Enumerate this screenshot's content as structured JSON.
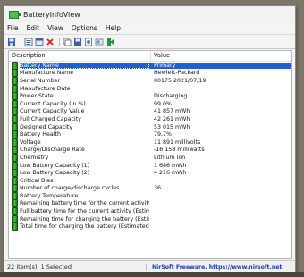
{
  "window": {
    "title": "BatteryInfoView"
  },
  "menu": [
    "File",
    "Edit",
    "View",
    "Options",
    "Help"
  ],
  "toolbar_icons": [
    "save-icon",
    "properties-icon",
    "refresh-icon",
    "delete-icon",
    "copy-icon",
    "save-select-icon",
    "html-report-icon",
    "about-icon",
    "exit-icon"
  ],
  "columns": {
    "description": "Description",
    "value": "Value"
  },
  "rows": [
    {
      "d": "Battery Name",
      "v": "Primary",
      "selected": true
    },
    {
      "d": "Manufacture Name",
      "v": "Hewlett-Packard"
    },
    {
      "d": "Serial Number",
      "v": "00175 2021/07/19"
    },
    {
      "d": "Manufacture Date",
      "v": ""
    },
    {
      "d": "Power State",
      "v": "Discharging"
    },
    {
      "d": "Current Capacity (in %)",
      "v": "99.0%"
    },
    {
      "d": "Current Capacity Value",
      "v": "41 857 mWh"
    },
    {
      "d": "Full Charged Capacity",
      "v": "42 261 mWh"
    },
    {
      "d": "Designed Capacity",
      "v": "53 015 mWh"
    },
    {
      "d": "Battery Health",
      "v": "79.7%"
    },
    {
      "d": "Voltage",
      "v": "11 891 millivolts"
    },
    {
      "d": "Charge/Discharge Rate",
      "v": "-16 158 milliwatts"
    },
    {
      "d": "Chemistry",
      "v": "Lithium Ion"
    },
    {
      "d": "Low Battery Capacity (1)",
      "v": "1 686 mWh"
    },
    {
      "d": "Low Battery Capacity (2)",
      "v": "4 216 mWh"
    },
    {
      "d": "Critical Bias",
      "v": ""
    },
    {
      "d": "Number of charge/discharge cycles",
      "v": "36"
    },
    {
      "d": "Battery Temperature",
      "v": ""
    },
    {
      "d": "Remaining battery time for the current activity (Est...",
      "v": ""
    },
    {
      "d": "Full battery time for the current activity (Estimated)",
      "v": ""
    },
    {
      "d": "Remaining time for charging the battery (Estimated)",
      "v": ""
    },
    {
      "d": "Total  time for charging the battery (Estimated)",
      "v": ""
    }
  ],
  "status": {
    "items": "22 item(s), 1 Selected",
    "credit": "NirSoft Freeware. https://www.nirsoft.net"
  },
  "colors": {
    "selection": "#1f5fd0",
    "link": "#1a3fb5"
  }
}
